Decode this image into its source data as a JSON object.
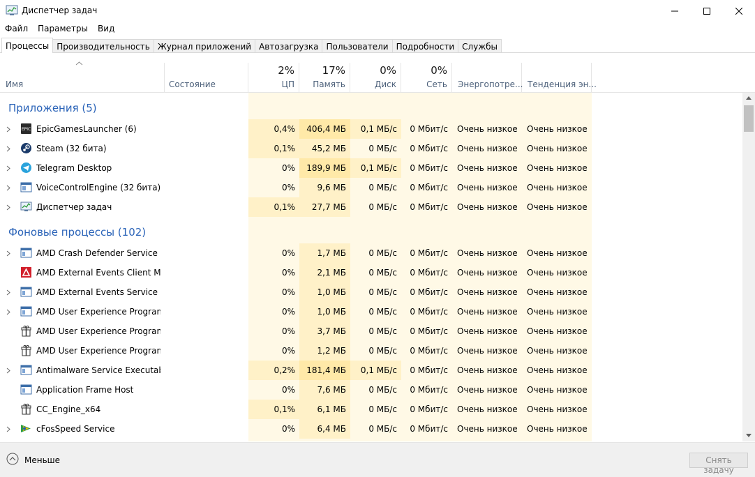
{
  "window": {
    "title": "Диспетчер задач",
    "icon": "task-manager-icon"
  },
  "menu": [
    "Файл",
    "Параметры",
    "Вид"
  ],
  "tabs": [
    {
      "label": "Процессы",
      "active": true
    },
    {
      "label": "Производительность"
    },
    {
      "label": "Журнал приложений"
    },
    {
      "label": "Автозагрузка"
    },
    {
      "label": "Пользователи"
    },
    {
      "label": "Подробности"
    },
    {
      "label": "Службы"
    }
  ],
  "columns": {
    "name": "Имя",
    "status": "Состояние",
    "cpu": {
      "pct": "2%",
      "label": "ЦП"
    },
    "memory": {
      "pct": "17%",
      "label": "Память"
    },
    "disk": {
      "pct": "0%",
      "label": "Диск"
    },
    "network": {
      "pct": "0%",
      "label": "Сеть"
    },
    "power": "Энергопотре...",
    "trend": "Тенденция эн..."
  },
  "groups": [
    {
      "title": "Приложения (5)",
      "processes": [
        {
          "name": "EpicGamesLauncher (6)",
          "icon": "epic-games-icon",
          "expandable": true,
          "cpu": "0,4%",
          "mem": "406,4 МБ",
          "disk": "0,1 МБ/с",
          "net": "0 Мбит/с",
          "power": "Очень низкое",
          "trend": "Очень низкое",
          "hl": [
            1,
            2,
            1
          ]
        },
        {
          "name": "Steam (32 бита)",
          "icon": "steam-icon",
          "expandable": true,
          "cpu": "0,1%",
          "mem": "45,2 МБ",
          "disk": "0 МБ/с",
          "net": "0 Мбит/с",
          "power": "Очень низкое",
          "trend": "Очень низкое",
          "hl": [
            1,
            1,
            0
          ]
        },
        {
          "name": "Telegram Desktop",
          "icon": "telegram-icon",
          "expandable": true,
          "cpu": "0%",
          "mem": "189,9 МБ",
          "disk": "0,1 МБ/с",
          "net": "0 Мбит/с",
          "power": "Очень низкое",
          "trend": "Очень низкое",
          "hl": [
            0,
            2,
            1
          ]
        },
        {
          "name": "VoiceControlEngine (32 бита)",
          "icon": "app-window-icon",
          "expandable": true,
          "cpu": "0%",
          "mem": "9,6 МБ",
          "disk": "0 МБ/с",
          "net": "0 Мбит/с",
          "power": "Очень низкое",
          "trend": "Очень низкое",
          "hl": [
            0,
            1,
            0
          ]
        },
        {
          "name": "Диспетчер задач",
          "icon": "task-manager-icon",
          "expandable": true,
          "cpu": "0,1%",
          "mem": "27,7 МБ",
          "disk": "0 МБ/с",
          "net": "0 Мбит/с",
          "power": "Очень низкое",
          "trend": "Очень низкое",
          "hl": [
            1,
            1,
            0
          ]
        }
      ]
    },
    {
      "title": "Фоновые процессы (102)",
      "processes": [
        {
          "name": "AMD Crash Defender Service",
          "icon": "service-icon",
          "expandable": true,
          "cpu": "0%",
          "mem": "1,7 МБ",
          "disk": "0 МБ/с",
          "net": "0 Мбит/с",
          "power": "Очень низкое",
          "trend": "Очень низкое",
          "hl": [
            0,
            1,
            0
          ]
        },
        {
          "name": "AMD External Events Client Mo...",
          "icon": "amd-icon",
          "expandable": false,
          "cpu": "0%",
          "mem": "2,1 МБ",
          "disk": "0 МБ/с",
          "net": "0 Мбит/с",
          "power": "Очень низкое",
          "trend": "Очень низкое",
          "hl": [
            0,
            1,
            0
          ]
        },
        {
          "name": "AMD External Events Service M...",
          "icon": "service-icon",
          "expandable": true,
          "cpu": "0%",
          "mem": "1,0 МБ",
          "disk": "0 МБ/с",
          "net": "0 Мбит/с",
          "power": "Очень низкое",
          "trend": "Очень низкое",
          "hl": [
            0,
            1,
            0
          ]
        },
        {
          "name": "AMD User Experience Program ...",
          "icon": "service-icon",
          "expandable": true,
          "cpu": "0%",
          "mem": "1,0 МБ",
          "disk": "0 МБ/с",
          "net": "0 Мбит/с",
          "power": "Очень низкое",
          "trend": "Очень низкое",
          "hl": [
            0,
            1,
            0
          ]
        },
        {
          "name": "AMD User Experience Program ...",
          "icon": "gift-box-icon",
          "expandable": false,
          "cpu": "0%",
          "mem": "3,7 МБ",
          "disk": "0 МБ/с",
          "net": "0 Мбит/с",
          "power": "Очень низкое",
          "trend": "Очень низкое",
          "hl": [
            0,
            1,
            0
          ]
        },
        {
          "name": "AMD User Experience Program ...",
          "icon": "gift-box-icon",
          "expandable": false,
          "cpu": "0%",
          "mem": "1,2 МБ",
          "disk": "0 МБ/с",
          "net": "0 Мбит/с",
          "power": "Очень низкое",
          "trend": "Очень низкое",
          "hl": [
            0,
            1,
            0
          ]
        },
        {
          "name": "Antimalware Service Executable",
          "icon": "service-icon",
          "expandable": true,
          "cpu": "0,2%",
          "mem": "181,4 МБ",
          "disk": "0,1 МБ/с",
          "net": "0 Мбит/с",
          "power": "Очень низкое",
          "trend": "Очень низкое",
          "hl": [
            1,
            2,
            1
          ]
        },
        {
          "name": "Application Frame Host",
          "icon": "service-icon",
          "expandable": false,
          "cpu": "0%",
          "mem": "7,6 МБ",
          "disk": "0 МБ/с",
          "net": "0 Мбит/с",
          "power": "Очень низкое",
          "trend": "Очень низкое",
          "hl": [
            0,
            1,
            0
          ]
        },
        {
          "name": "CC_Engine_x64",
          "icon": "gift-box-icon",
          "expandable": false,
          "cpu": "0,1%",
          "mem": "6,1 МБ",
          "disk": "0 МБ/с",
          "net": "0 Мбит/с",
          "power": "Очень низкое",
          "trend": "Очень низкое",
          "hl": [
            1,
            1,
            0
          ]
        },
        {
          "name": "cFosSpeed Service",
          "icon": "cfos-icon",
          "expandable": true,
          "cpu": "0%",
          "mem": "6,4 МБ",
          "disk": "0 МБ/с",
          "net": "0 Мбит/с",
          "power": "Очень низкое",
          "trend": "Очень низкое",
          "hl": [
            0,
            1,
            0
          ]
        }
      ]
    }
  ],
  "colors": {
    "heat0": "#fff9e6",
    "heat1": "#fff1c8",
    "heat2": "#ffe9a8",
    "group_title": "#2a63b8"
  },
  "footer": {
    "less_label": "Меньше",
    "end_task_label": "Снять задачу"
  }
}
